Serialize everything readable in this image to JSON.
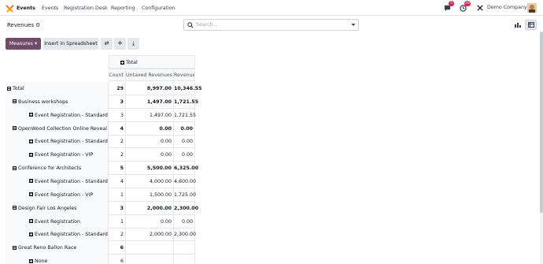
{
  "navbar": {
    "app_name": "Events",
    "menu": [
      "Events",
      "Registration Desk",
      "Reporting",
      "Configuration"
    ],
    "messages_count": "5",
    "activities_count": "29",
    "company": "Demo Company"
  },
  "control": {
    "breadcrumb": "Revenues",
    "search_placeholder": "Search...",
    "measures_label": "Measures",
    "insert_label": "Insert in Spreadsheet"
  },
  "pivot": {
    "col_group_label": "Total",
    "columns": [
      "Count",
      "Untaxed Revenues",
      "Revenues"
    ],
    "rows": [
      {
        "label": "Total",
        "level": 0,
        "type": "minus",
        "count": "29",
        "untaxed": "8,997.00",
        "revenue": "10,346.55",
        "bold": true
      },
      {
        "label": "Business workshops",
        "level": 1,
        "type": "minus",
        "count": "3",
        "untaxed": "1,497.00",
        "revenue": "1,721.55",
        "bold": true
      },
      {
        "label": "Event Registration - Standard",
        "level": 2,
        "type": "plus",
        "count": "3",
        "untaxed": "1,497.00",
        "revenue": "1,721.55",
        "bold": false
      },
      {
        "label": "OpenWood Collection Online Reveal",
        "level": 1,
        "type": "minus",
        "count": "4",
        "untaxed": "0.00",
        "revenue": "0.00",
        "bold": true
      },
      {
        "label": "Event Registration - Standard",
        "level": 2,
        "type": "plus",
        "count": "2",
        "untaxed": "0.00",
        "revenue": "0.00",
        "bold": false
      },
      {
        "label": "Event Registration - VIP",
        "level": 2,
        "type": "plus",
        "count": "2",
        "untaxed": "0.00",
        "revenue": "0.00",
        "bold": false
      },
      {
        "label": "Conference for Architects",
        "level": 1,
        "type": "minus",
        "count": "5",
        "untaxed": "5,500.00",
        "revenue": "6,325.00",
        "bold": true
      },
      {
        "label": "Event Registration - Standard",
        "level": 2,
        "type": "plus",
        "count": "4",
        "untaxed": "4,000.00",
        "revenue": "4,600.00",
        "bold": false
      },
      {
        "label": "Event Registration - VIP",
        "level": 2,
        "type": "plus",
        "count": "1",
        "untaxed": "1,500.00",
        "revenue": "1,725.00",
        "bold": false
      },
      {
        "label": "Design Fair Los Angeles",
        "level": 1,
        "type": "minus",
        "count": "3",
        "untaxed": "2,000.00",
        "revenue": "2,300.00",
        "bold": true
      },
      {
        "label": "Event Registration",
        "level": 2,
        "type": "plus",
        "count": "1",
        "untaxed": "0.00",
        "revenue": "0.00",
        "bold": false
      },
      {
        "label": "Event Registration - Standard",
        "level": 2,
        "type": "plus",
        "count": "2",
        "untaxed": "2,000.00",
        "revenue": "2,300.00",
        "bold": false
      },
      {
        "label": "Great Reno Ballon Race",
        "level": 1,
        "type": "minus",
        "count": "6",
        "untaxed": "",
        "revenue": "",
        "bold": true
      },
      {
        "label": "None",
        "level": 2,
        "type": "plus",
        "count": "6",
        "untaxed": "",
        "revenue": "",
        "bold": false
      }
    ]
  },
  "colors": {
    "brand": "#714b67",
    "badge": "#e11d48"
  }
}
